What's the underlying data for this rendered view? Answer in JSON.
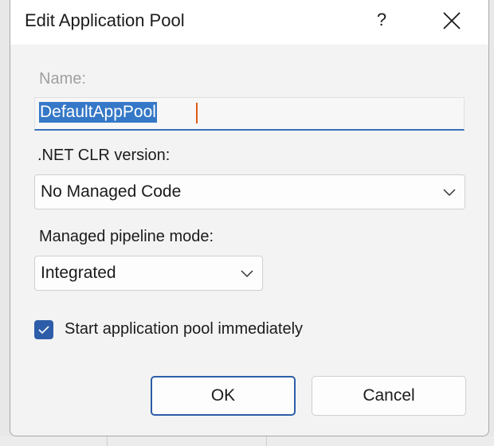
{
  "dialog": {
    "title": "Edit Application Pool",
    "help_label": "?"
  },
  "name": {
    "label": "Name:",
    "value": "DefaultAppPool"
  },
  "clr": {
    "label": ".NET CLR version:",
    "selected": "No Managed Code"
  },
  "pipeline": {
    "label": "Managed pipeline mode:",
    "selected": "Integrated"
  },
  "start": {
    "label": "Start application pool immediately",
    "checked": true
  },
  "buttons": {
    "ok": "OK",
    "cancel": "Cancel"
  },
  "icons": {
    "close": "close-icon",
    "chevron": "chevron-down-icon",
    "check": "checkmark-icon"
  },
  "colors": {
    "accent": "#2d5da8",
    "selection": "#3478c7"
  }
}
